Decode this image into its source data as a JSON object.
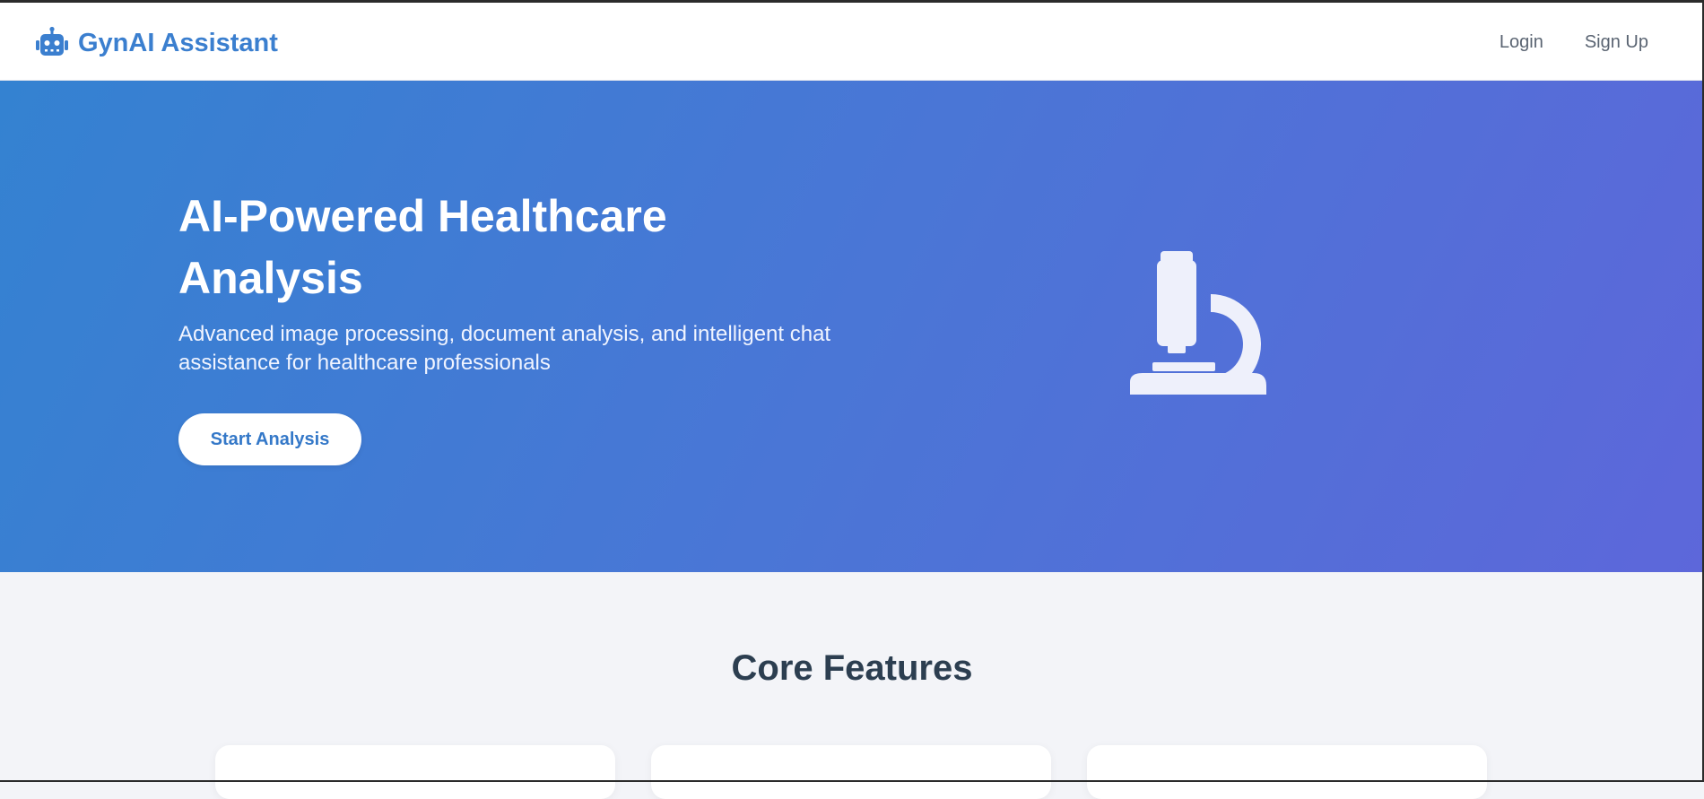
{
  "navbar": {
    "brand_label": "GynAI Assistant",
    "brand_icon": "robot-icon",
    "links": [
      {
        "label": "Login"
      },
      {
        "label": "Sign Up"
      }
    ]
  },
  "hero": {
    "title": "AI-Powered Healthcare Analysis",
    "subtitle": "Advanced image processing, document analysis, and intelligent chat assistance for healthcare professionals",
    "cta_label": "Start Analysis",
    "illustration": "microscope-icon"
  },
  "features": {
    "title": "Core Features"
  },
  "colors": {
    "brand": "#3b7fcf",
    "hero_gradient_start": "#3482d1",
    "hero_gradient_end": "#5d67da",
    "heading": "#2c3e50"
  }
}
